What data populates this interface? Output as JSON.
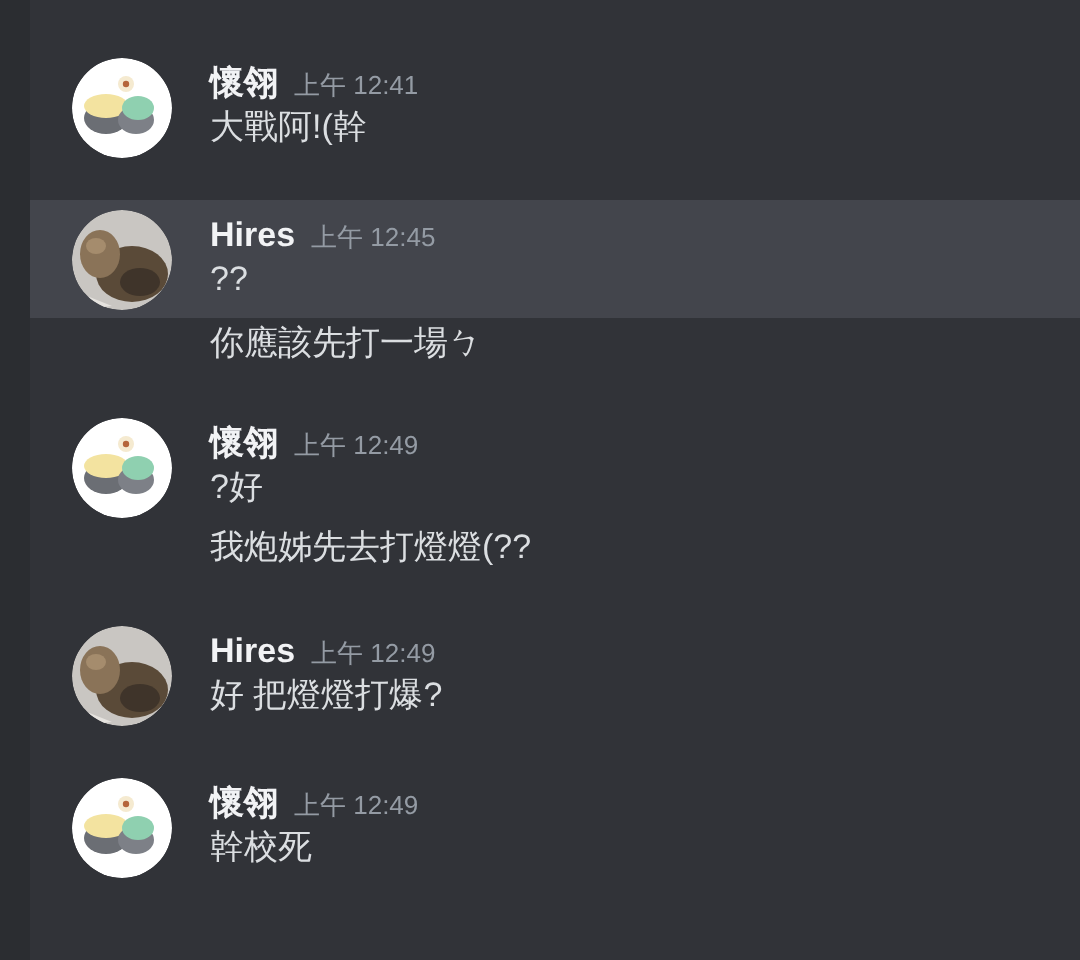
{
  "messages": [
    {
      "author": "懷翎",
      "time": "上午 12:41",
      "selected": false,
      "lines": [
        "大戰阿!(幹"
      ]
    },
    {
      "author": "Hires",
      "time": "上午 12:45",
      "selected": true,
      "lines": [
        "??"
      ]
    },
    {
      "selected": false,
      "lines": [
        "你應該先打一場ㄅ"
      ]
    },
    {
      "author": "懷翎",
      "time": "上午 12:49",
      "selected": false,
      "lines": [
        "?好",
        "我炮姊先去打燈燈(??"
      ]
    },
    {
      "author": "Hires",
      "time": "上午 12:49",
      "selected": false,
      "lines": [
        "好 把燈燈打爆?"
      ]
    },
    {
      "author": "懷翎",
      "time": "上午 12:49",
      "selected": false,
      "lines": [
        "幹校死"
      ]
    }
  ]
}
